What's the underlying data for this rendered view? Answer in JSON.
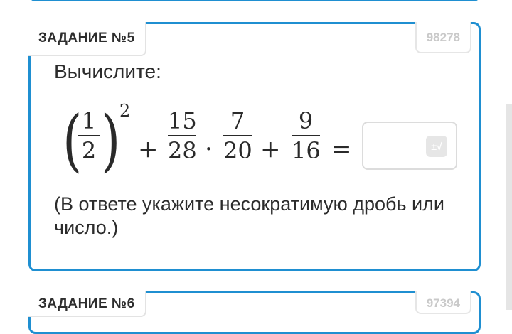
{
  "task": {
    "label": "ЗАДАНИЕ №5",
    "id": "98278",
    "instruction": "Вычислите:",
    "note": "(В ответе укажите несократимую дробь или число.)",
    "expression": {
      "f1": {
        "num": "1",
        "den": "2"
      },
      "exponent": "2",
      "plus1": "+",
      "f2": {
        "num": "15",
        "den": "28"
      },
      "dot": "·",
      "f3": {
        "num": "7",
        "den": "20"
      },
      "plus2": "+",
      "f4": {
        "num": "9",
        "den": "16"
      },
      "equals": "="
    },
    "answer": {
      "value": "",
      "icon": "math-keyboard-icon"
    }
  },
  "next_task": {
    "label": "ЗАДАНИЕ №6",
    "id": "97394"
  },
  "colors": {
    "accent": "#1f8fd1",
    "muted": "#c9c9c9"
  }
}
